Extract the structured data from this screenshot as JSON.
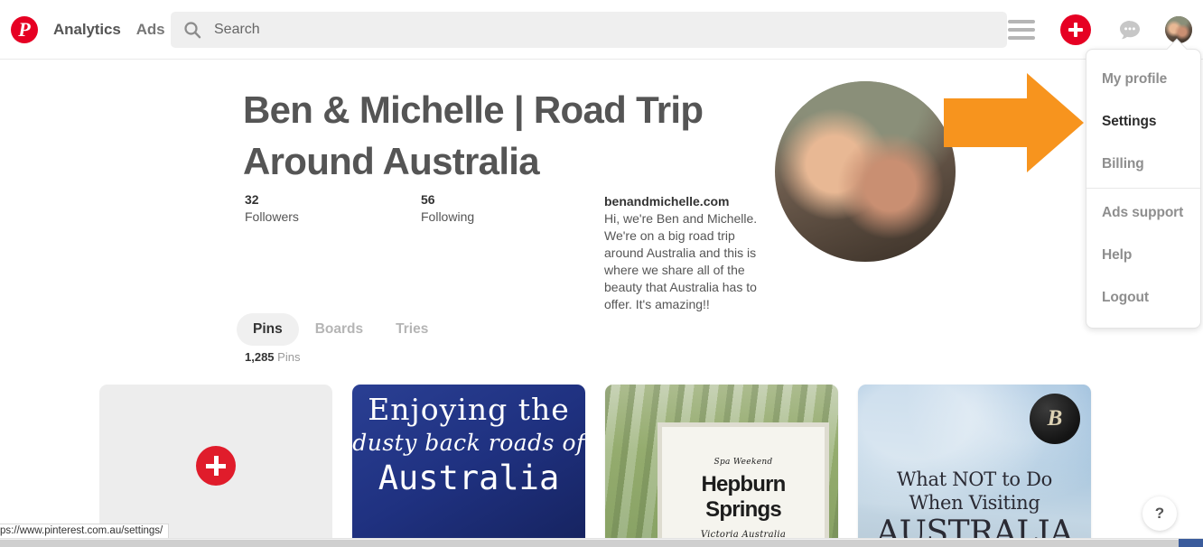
{
  "header": {
    "logo_icon": "pinterest-logo-icon",
    "nav": [
      {
        "label": "Analytics"
      },
      {
        "label": "Ads"
      }
    ],
    "search": {
      "icon": "search-icon",
      "placeholder": "Search",
      "value": ""
    },
    "actions": {
      "hamburger_icon": "hamburger-menu-icon",
      "create_icon": "plus-icon",
      "messages_icon": "chat-bubble-icon",
      "avatar_icon": "avatar-icon"
    }
  },
  "dropdown": {
    "items": [
      {
        "label": "My profile",
        "active": false
      },
      {
        "label": "Settings",
        "active": true
      },
      {
        "label": "Billing",
        "active": false
      },
      {
        "label": "Ads support",
        "active": false
      },
      {
        "label": "Help",
        "active": false
      },
      {
        "label": "Logout",
        "active": false
      }
    ]
  },
  "annotation": {
    "arrow_icon": "orange-arrow-annotation",
    "color": "#F7941E"
  },
  "profile": {
    "title": "Ben & Michelle | Road Trip Around Australia",
    "stats": [
      {
        "value": "32",
        "label": "Followers"
      },
      {
        "value": "56",
        "label": "Following"
      }
    ],
    "website": "benandmichelle.com",
    "bio": "Hi, we're Ben and Michelle. We're on a big road trip around Australia and this is where we share all of the beauty that Australia has to offer. It's amazing!!",
    "photo_icon": "profile-photo"
  },
  "tabs": {
    "items": [
      {
        "label": "Pins",
        "active": true
      },
      {
        "label": "Boards",
        "active": false
      },
      {
        "label": "Tries",
        "active": false
      }
    ],
    "count_value": "1,285",
    "count_label": "Pins"
  },
  "pins": {
    "add_card": {
      "icon": "add-pin-icon"
    },
    "cards": [
      {
        "name": "pin-card-dusty-roads",
        "line1": "Enjoying the",
        "line2": "dusty back roads of",
        "line3": "Australia"
      },
      {
        "name": "pin-card-hepburn-springs",
        "line1": "Spa Weekend",
        "line2": "Hepburn Springs",
        "line3": "Victoria Australia"
      },
      {
        "name": "pin-card-what-not-to-do",
        "badge": "B",
        "line1": "What NOT to Do",
        "line2": "When Visiting",
        "line3": "AUSTRALIA"
      }
    ]
  },
  "help": {
    "label": "?"
  },
  "statusbar": {
    "url": "ps://www.pinterest.com.au/settings/"
  },
  "colors": {
    "brand_red": "#E60023",
    "annotation_orange": "#F7941E",
    "text_dark": "#555555",
    "text_muted": "#8E8E8E"
  }
}
